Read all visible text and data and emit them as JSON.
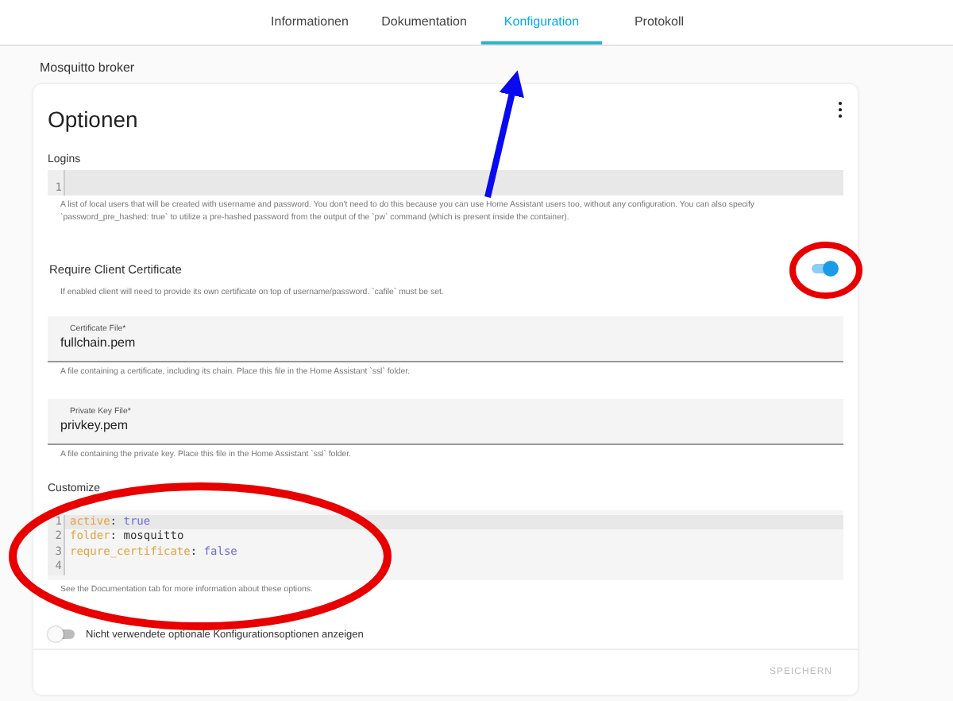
{
  "tabs": [
    {
      "label": "Informationen",
      "selected": false
    },
    {
      "label": "Dokumentation",
      "selected": false
    },
    {
      "label": "Konfiguration",
      "selected": true
    },
    {
      "label": "Protokoll",
      "selected": false
    }
  ],
  "addon_title": "Mosquitto broker",
  "card": {
    "title": "Optionen",
    "sections": [
      {
        "kind": "code",
        "label": "Logins",
        "lines": [
          {
            "number": "1",
            "active": true
          }
        ],
        "help": "A list of local users that will be created with username and password. You don't need to do this because you can use Home Assistant users too, without any configuration. You can also specify `password_pre_hashed: true` to utilize a pre-hashed password from the output of the `pw` command (which is present inside the container)."
      },
      {
        "kind": "switch",
        "label": "Require Client Certificate",
        "on": true,
        "help": "If enabled client will need to provide its own certificate on top of username/password. `cafile` must be set."
      },
      {
        "kind": "text",
        "label": "Certificate File*",
        "value": "fullchain.pem",
        "help": "A file containing a certificate, including its chain. Place this file in the Home Assistant `ssl` folder."
      },
      {
        "kind": "text",
        "label": "Private Key File*",
        "value": "privkey.pem",
        "help": "A file containing the private key. Place this file in the Home Assistant `ssl` folder."
      },
      {
        "kind": "code",
        "label": "Customize",
        "lines": [
          {
            "number": "1",
            "active": true,
            "tokens": [
              {
                "kind": "key",
                "text": "active"
              },
              {
                "kind": "punct",
                "text": ": "
              },
              {
                "kind": "bool",
                "text": "true"
              }
            ]
          },
          {
            "number": "2",
            "active": false,
            "tokens": [
              {
                "kind": "key",
                "text": "folder"
              },
              {
                "kind": "punct",
                "text": ": "
              },
              {
                "kind": "plain",
                "text": "mosquitto"
              }
            ]
          },
          {
            "number": "3",
            "active": false,
            "tokens": [
              {
                "kind": "key",
                "text": "requre_certificate"
              },
              {
                "kind": "punct",
                "text": ": "
              },
              {
                "kind": "bool",
                "text": "false"
              }
            ]
          },
          {
            "number": "4",
            "active": false
          }
        ],
        "help": "See the Documentation tab for more information about these options."
      }
    ],
    "show_unused": {
      "label": "Nicht verwendete optionale Konfigurationsoptionen anzeigen",
      "on": false
    },
    "save_button": {
      "label": "SPEICHERN",
      "disabled": true
    }
  }
}
